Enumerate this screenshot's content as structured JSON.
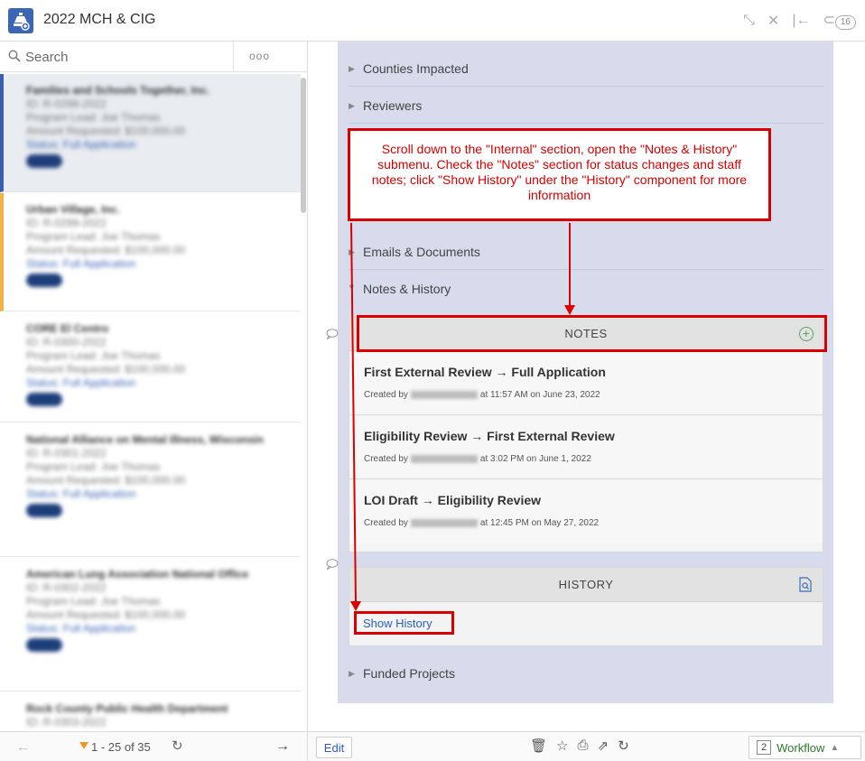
{
  "app": {
    "title": "2022 MCH & CIG",
    "record_count_badge": "16"
  },
  "search": {
    "placeholder": "Search",
    "more_label": "ooo"
  },
  "records": [
    {
      "name": "Families and Schools Together, Inc.",
      "id": "ID: R-0298-2022",
      "program": "Program Lead: Joe Thomas",
      "amount": "Amount Requested: $100,000.00",
      "status": "Status: Full Application",
      "badge": "LATE"
    },
    {
      "name": "Urban Village, Inc.",
      "id": "ID: R-0299-2022",
      "program": "Program Lead: Joe Thomas",
      "amount": "Amount Requested: $100,000.00",
      "status": "Status: Full Application",
      "badge": "LATE"
    },
    {
      "name": "CORE El Centro",
      "id": "ID: R-0300-2022",
      "program": "Program Lead: Joe Thomas",
      "amount": "Amount Requested: $100,000.00",
      "status": "Status: Full Application",
      "badge": "LATE"
    },
    {
      "name": "National Alliance on Mental Illness, Wisconsin",
      "id": "ID: R-0301-2022",
      "program": "Program Lead: Joe Thomas",
      "amount": "Amount Requested: $100,000.00",
      "status": "Status: Full Application",
      "badge": "LATE"
    },
    {
      "name": "American Lung Association National Office",
      "id": "ID: R-0302-2022",
      "program": "Program Lead: Joe Thomas",
      "amount": "Amount Requested: $100,000.00",
      "status": "Status: Full Application",
      "badge": "LATE"
    },
    {
      "name": "Rock County Public Health Department",
      "id": "ID: R-0303-2022"
    }
  ],
  "pager": {
    "range": "1 - 25 of 35"
  },
  "sections": {
    "counties": "Counties Impacted",
    "reviewers": "Reviewers",
    "emails": "Emails & Documents",
    "notes_history": "Notes & History",
    "funded": "Funded Projects"
  },
  "notes": {
    "header": "NOTES",
    "items": [
      {
        "title": "First External Review → Full Application",
        "created_prefix": "Created by",
        "created_suffix": "at 11:57 AM on June 23, 2022"
      },
      {
        "title": "Eligibility Review → First External Review",
        "created_prefix": "Created by",
        "created_suffix": "at 3:02 PM on June 1, 2022"
      },
      {
        "title": "LOI Draft → Eligibility Review",
        "created_prefix": "Created by",
        "created_suffix": "at 12:45 PM on May 27, 2022"
      }
    ]
  },
  "history": {
    "header": "HISTORY",
    "show_label": "Show History"
  },
  "actions": {
    "edit_label": "Edit",
    "workflow_count": "2",
    "workflow_label": "Workflow"
  },
  "annotation": {
    "text": "Scroll down to the \"Internal\" section, open the \"Notes & History\" submenu. Check the \"Notes\" section for status changes and staff notes; click \"Show History\" under the \"History\" component for more information",
    "color": "#d80000"
  }
}
